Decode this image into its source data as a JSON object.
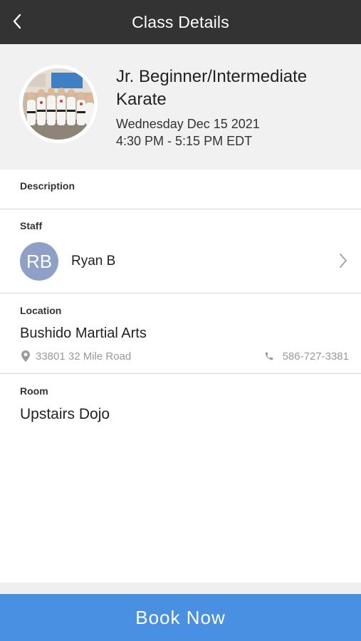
{
  "header": {
    "title": "Class Details",
    "back_icon": "chevron-left-icon"
  },
  "class_info": {
    "name": "Jr. Beginner/Intermediate Karate",
    "date": "Wednesday Dec 15 2021",
    "time": "4:30 PM - 5:15 PM EDT"
  },
  "description": {
    "label": "Description"
  },
  "staff": {
    "label": "Staff",
    "initials": "RB",
    "name": "Ryan B",
    "avatar_color": "#8ea0c6"
  },
  "location": {
    "label": "Location",
    "name": "Bushido Martial Arts",
    "address": "33801 32 Mile Road",
    "phone": "586-727-3381"
  },
  "room": {
    "label": "Room",
    "name": "Upstairs Dojo"
  },
  "footer": {
    "book_label": "Book Now",
    "accent": "#4a90e2"
  }
}
